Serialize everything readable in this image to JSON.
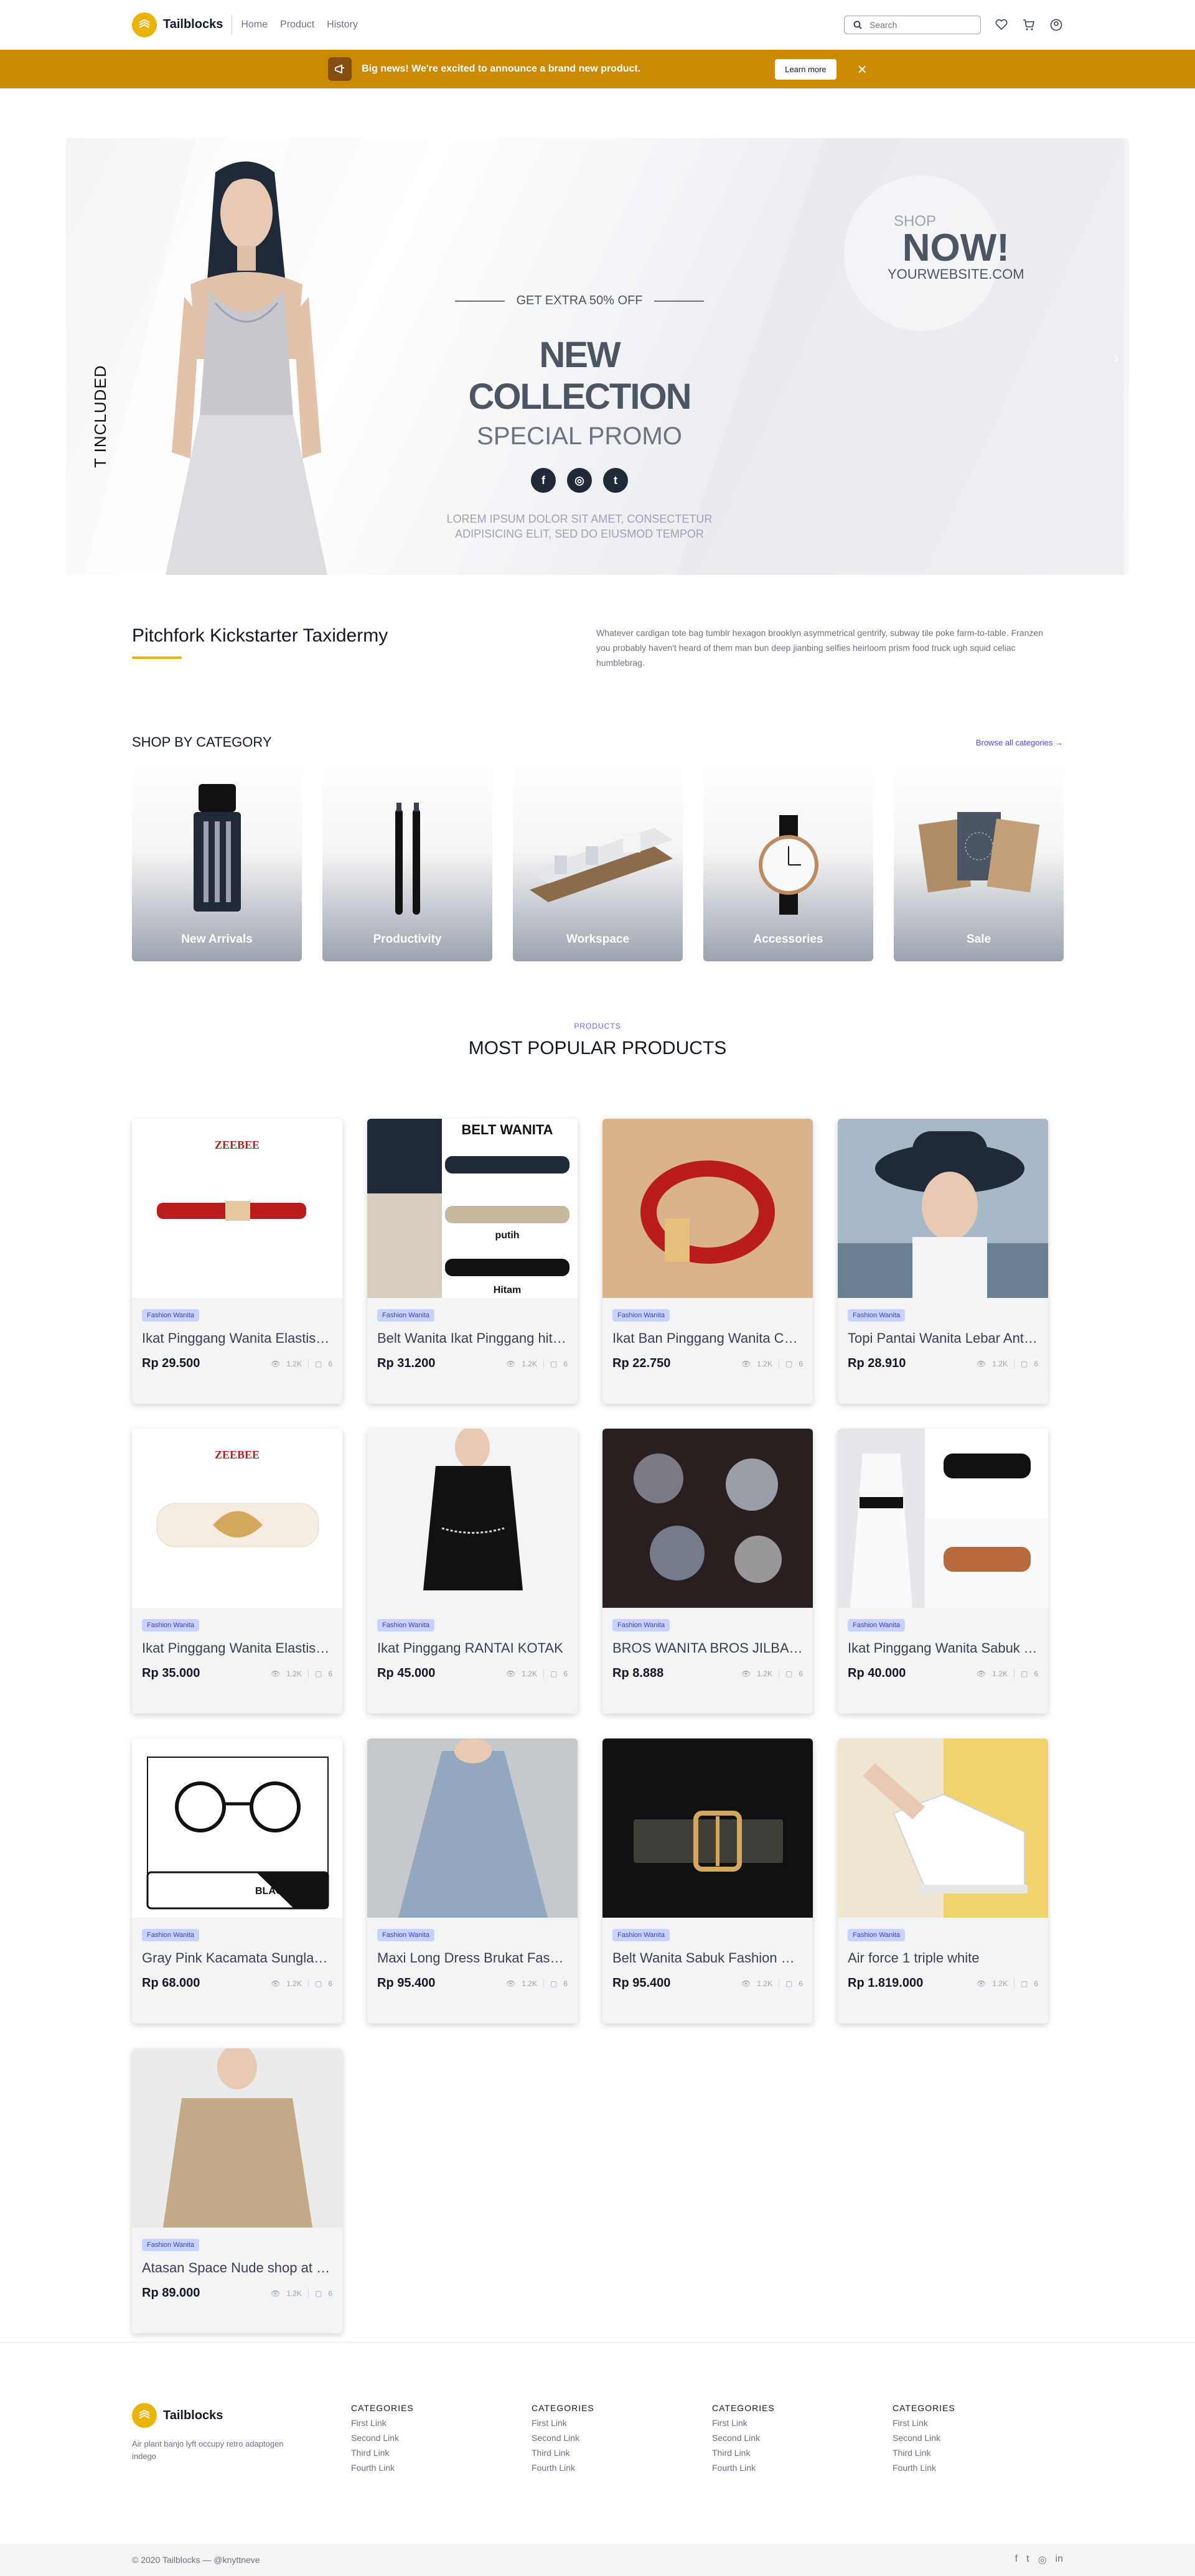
{
  "nav": {
    "brand": "Tailblocks",
    "links": [
      "Home",
      "Product",
      "History"
    ],
    "search_placeholder": "Search",
    "icons": [
      "heart-icon",
      "cart-icon",
      "user-icon"
    ]
  },
  "banner": {
    "text": "Big news! We're excited to announce a brand new product.",
    "button": "Learn more",
    "close": "×"
  },
  "hero": {
    "vertical": "T INCLUDED",
    "extra": "GET EXTRA 50% OFF",
    "title": "NEW COLLECTION",
    "subtitle": "SPECIAL PROMO",
    "lorem1": "LOREM IPSUM DOLOR SIT AMET, CONSECTETUR",
    "lorem2": "ADIPISICING ELIT, SED DO EIUSMOD TEMPOR",
    "shop": "SHOP",
    "now": "NOW!",
    "website": "YOURWEBSITE.COM",
    "social": [
      "f",
      "◎",
      "t"
    ]
  },
  "intro": {
    "title": "Pitchfork Kickstarter Taxidermy",
    "text": "Whatever cardigan tote bag tumblr hexagon brooklyn asymmetrical gentrify, subway tile poke farm-to-table. Franzen you probably haven't heard of them man bun deep jianbing selfies heirloom prism food truck ugh squid celiac humblebrag."
  },
  "categories": {
    "title": "SHOP BY CATEGORY",
    "browse": "Browse all categories →",
    "items": [
      "New Arrivals",
      "Productivity",
      "Workspace",
      "Accessories",
      "Sale"
    ]
  },
  "products": {
    "tag": "PRODUCTS",
    "title": "MOST POPULAR PRODUCTS",
    "items": [
      {
        "badge": "Fashion Wanita",
        "name": "Ikat Pinggang Wanita Elastis Motif",
        "price": "Rp 29.500",
        "views": "1.2K",
        "comments": "6"
      },
      {
        "badge": "Fashion Wanita",
        "name": "Belt Wanita Ikat Pinggang hitam",
        "price": "Rp 31.200",
        "views": "1.2K",
        "comments": "6"
      },
      {
        "badge": "Fashion Wanita",
        "name": "Ikat Ban Pinggang Wanita Casual",
        "price": "Rp 22.750",
        "views": "1.2K",
        "comments": "6"
      },
      {
        "badge": "Fashion Wanita",
        "name": "Topi Pantai Wanita Lebar Anti UV",
        "price": "Rp 28.910",
        "views": "1.2K",
        "comments": "6"
      },
      {
        "badge": "Fashion Wanita",
        "name": "Ikat Pinggang Wanita Elastis Daun",
        "price": "Rp 35.000",
        "views": "1.2K",
        "comments": "6"
      },
      {
        "badge": "Fashion Wanita",
        "name": "Ikat Pinggang RANTAI KOTAK",
        "price": "Rp 45.000",
        "views": "1.2K",
        "comments": "6"
      },
      {
        "badge": "Fashion Wanita",
        "name": "BROS WANITA BROS JILBAB CANTIK",
        "price": "Rp 8.888",
        "views": "1.2K",
        "comments": "6"
      },
      {
        "badge": "Fashion Wanita",
        "name": "Ikat Pinggang Wanita Sabuk Tali",
        "price": "Rp 40.000",
        "views": "1.2K",
        "comments": "6"
      },
      {
        "badge": "Fashion Wanita",
        "name": "Gray Pink Kacamata Sunglasses",
        "price": "Rp 68.000",
        "views": "1.2K",
        "comments": "6"
      },
      {
        "badge": "Fashion Wanita",
        "name": "Maxi Long Dress Brukat Fashion",
        "price": "Rp 95.400",
        "views": "1.2K",
        "comments": "6"
      },
      {
        "badge": "Fashion Wanita",
        "name": "Belt Wanita Sabuk Fashion Korea",
        "price": "Rp 95.400",
        "views": "1.2K",
        "comments": "6"
      },
      {
        "badge": "Fashion Wanita",
        "name": "Air force 1 triple white",
        "price": "Rp 1.819.000",
        "views": "1.2K",
        "comments": "6"
      },
      {
        "badge": "Fashion Wanita",
        "name": "Atasan Space Nude shop at tokyo",
        "price": "Rp 89.000",
        "views": "1.2K",
        "comments": "6"
      }
    ],
    "image_texts": {
      "zeebee": "ZEEBEE",
      "belt_title": "BELT WANITA",
      "putih": "putih",
      "hitam": "Hitam",
      "black_doff": "BLACK DOFF"
    }
  },
  "footer": {
    "brand": "Tailblocks",
    "desc": "Air plant banjo lyft occupy retro adaptogen indego",
    "cols": [
      {
        "title": "CATEGORIES",
        "links": [
          "First Link",
          "Second Link",
          "Third Link",
          "Fourth Link"
        ]
      },
      {
        "title": "CATEGORIES",
        "links": [
          "First Link",
          "Second Link",
          "Third Link",
          "Fourth Link"
        ]
      },
      {
        "title": "CATEGORIES",
        "links": [
          "First Link",
          "Second Link",
          "Third Link",
          "Fourth Link"
        ]
      },
      {
        "title": "CATEGORIES",
        "links": [
          "First Link",
          "Second Link",
          "Third Link",
          "Fourth Link"
        ]
      }
    ],
    "copyright": "© 2020 Tailblocks — @knyttneve",
    "social": [
      "f",
      "t",
      "◎",
      "in"
    ]
  },
  "colors": {
    "accent": "#eab308",
    "banner": "#ca8a04",
    "indigo": "#4f46e5"
  }
}
